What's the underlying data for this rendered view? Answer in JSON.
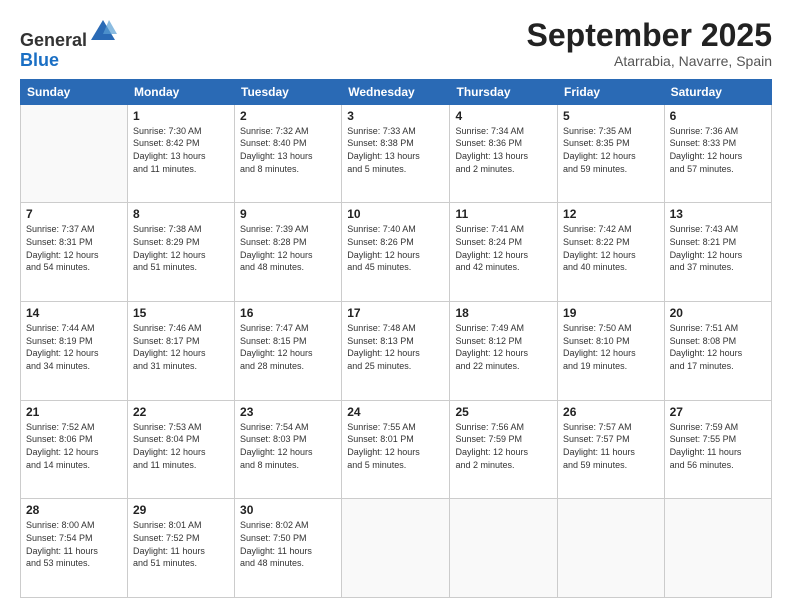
{
  "logo": {
    "line1": "General",
    "line2": "Blue"
  },
  "header": {
    "month": "September 2025",
    "location": "Atarrabia, Navarre, Spain"
  },
  "weekdays": [
    "Sunday",
    "Monday",
    "Tuesday",
    "Wednesday",
    "Thursday",
    "Friday",
    "Saturday"
  ],
  "weeks": [
    [
      {
        "day": "",
        "info": ""
      },
      {
        "day": "1",
        "info": "Sunrise: 7:30 AM\nSunset: 8:42 PM\nDaylight: 13 hours\nand 11 minutes."
      },
      {
        "day": "2",
        "info": "Sunrise: 7:32 AM\nSunset: 8:40 PM\nDaylight: 13 hours\nand 8 minutes."
      },
      {
        "day": "3",
        "info": "Sunrise: 7:33 AM\nSunset: 8:38 PM\nDaylight: 13 hours\nand 5 minutes."
      },
      {
        "day": "4",
        "info": "Sunrise: 7:34 AM\nSunset: 8:36 PM\nDaylight: 13 hours\nand 2 minutes."
      },
      {
        "day": "5",
        "info": "Sunrise: 7:35 AM\nSunset: 8:35 PM\nDaylight: 12 hours\nand 59 minutes."
      },
      {
        "day": "6",
        "info": "Sunrise: 7:36 AM\nSunset: 8:33 PM\nDaylight: 12 hours\nand 57 minutes."
      }
    ],
    [
      {
        "day": "7",
        "info": "Sunrise: 7:37 AM\nSunset: 8:31 PM\nDaylight: 12 hours\nand 54 minutes."
      },
      {
        "day": "8",
        "info": "Sunrise: 7:38 AM\nSunset: 8:29 PM\nDaylight: 12 hours\nand 51 minutes."
      },
      {
        "day": "9",
        "info": "Sunrise: 7:39 AM\nSunset: 8:28 PM\nDaylight: 12 hours\nand 48 minutes."
      },
      {
        "day": "10",
        "info": "Sunrise: 7:40 AM\nSunset: 8:26 PM\nDaylight: 12 hours\nand 45 minutes."
      },
      {
        "day": "11",
        "info": "Sunrise: 7:41 AM\nSunset: 8:24 PM\nDaylight: 12 hours\nand 42 minutes."
      },
      {
        "day": "12",
        "info": "Sunrise: 7:42 AM\nSunset: 8:22 PM\nDaylight: 12 hours\nand 40 minutes."
      },
      {
        "day": "13",
        "info": "Sunrise: 7:43 AM\nSunset: 8:21 PM\nDaylight: 12 hours\nand 37 minutes."
      }
    ],
    [
      {
        "day": "14",
        "info": "Sunrise: 7:44 AM\nSunset: 8:19 PM\nDaylight: 12 hours\nand 34 minutes."
      },
      {
        "day": "15",
        "info": "Sunrise: 7:46 AM\nSunset: 8:17 PM\nDaylight: 12 hours\nand 31 minutes."
      },
      {
        "day": "16",
        "info": "Sunrise: 7:47 AM\nSunset: 8:15 PM\nDaylight: 12 hours\nand 28 minutes."
      },
      {
        "day": "17",
        "info": "Sunrise: 7:48 AM\nSunset: 8:13 PM\nDaylight: 12 hours\nand 25 minutes."
      },
      {
        "day": "18",
        "info": "Sunrise: 7:49 AM\nSunset: 8:12 PM\nDaylight: 12 hours\nand 22 minutes."
      },
      {
        "day": "19",
        "info": "Sunrise: 7:50 AM\nSunset: 8:10 PM\nDaylight: 12 hours\nand 19 minutes."
      },
      {
        "day": "20",
        "info": "Sunrise: 7:51 AM\nSunset: 8:08 PM\nDaylight: 12 hours\nand 17 minutes."
      }
    ],
    [
      {
        "day": "21",
        "info": "Sunrise: 7:52 AM\nSunset: 8:06 PM\nDaylight: 12 hours\nand 14 minutes."
      },
      {
        "day": "22",
        "info": "Sunrise: 7:53 AM\nSunset: 8:04 PM\nDaylight: 12 hours\nand 11 minutes."
      },
      {
        "day": "23",
        "info": "Sunrise: 7:54 AM\nSunset: 8:03 PM\nDaylight: 12 hours\nand 8 minutes."
      },
      {
        "day": "24",
        "info": "Sunrise: 7:55 AM\nSunset: 8:01 PM\nDaylight: 12 hours\nand 5 minutes."
      },
      {
        "day": "25",
        "info": "Sunrise: 7:56 AM\nSunset: 7:59 PM\nDaylight: 12 hours\nand 2 minutes."
      },
      {
        "day": "26",
        "info": "Sunrise: 7:57 AM\nSunset: 7:57 PM\nDaylight: 11 hours\nand 59 minutes."
      },
      {
        "day": "27",
        "info": "Sunrise: 7:59 AM\nSunset: 7:55 PM\nDaylight: 11 hours\nand 56 minutes."
      }
    ],
    [
      {
        "day": "28",
        "info": "Sunrise: 8:00 AM\nSunset: 7:54 PM\nDaylight: 11 hours\nand 53 minutes."
      },
      {
        "day": "29",
        "info": "Sunrise: 8:01 AM\nSunset: 7:52 PM\nDaylight: 11 hours\nand 51 minutes."
      },
      {
        "day": "30",
        "info": "Sunrise: 8:02 AM\nSunset: 7:50 PM\nDaylight: 11 hours\nand 48 minutes."
      },
      {
        "day": "",
        "info": ""
      },
      {
        "day": "",
        "info": ""
      },
      {
        "day": "",
        "info": ""
      },
      {
        "day": "",
        "info": ""
      }
    ]
  ]
}
